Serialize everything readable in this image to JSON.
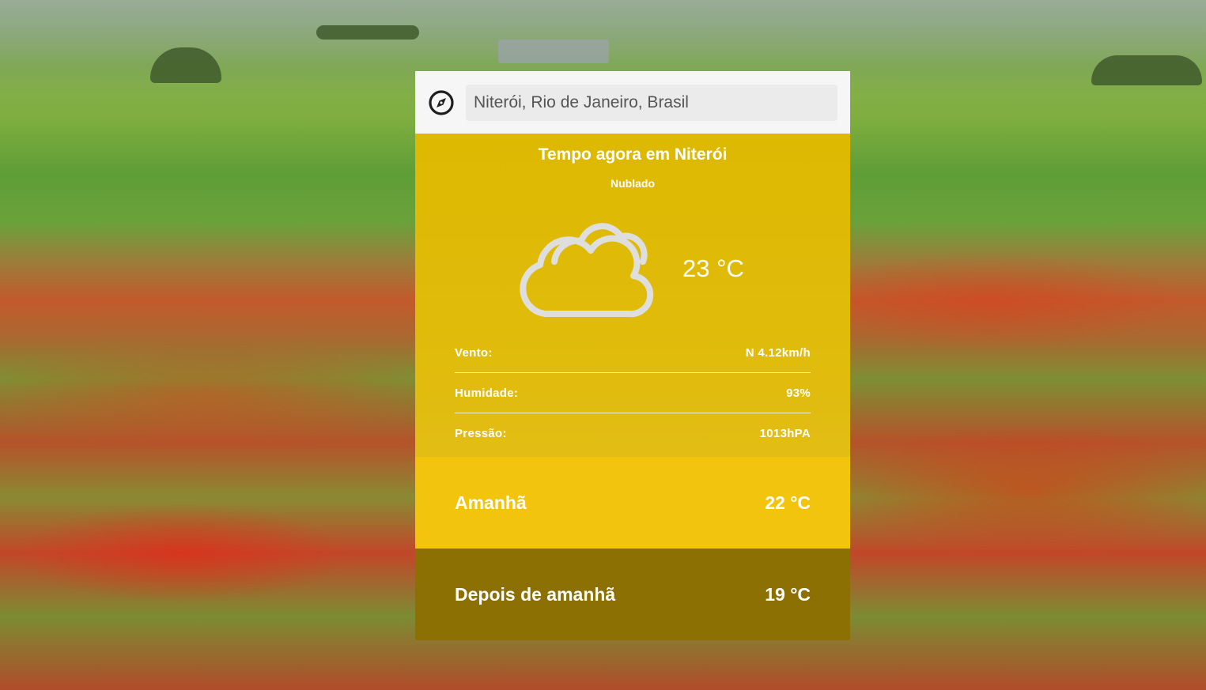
{
  "search": {
    "value": "Niterói, Rio de Janeiro, Brasil",
    "icon": "compass-icon"
  },
  "current": {
    "title": "Tempo agora em Niterói",
    "condition": "Nublado",
    "temperature": "23 °C",
    "icon": "cloudy-icon",
    "details": [
      {
        "label": "Vento:",
        "value": "N 4.12km/h"
      },
      {
        "label": "Humidade:",
        "value": "93%"
      },
      {
        "label": "Pressão:",
        "value": "1013hPA"
      }
    ]
  },
  "forecast": [
    {
      "day": "Amanhã",
      "temperature": "22 °C",
      "color": "#f2c40d"
    },
    {
      "day": "Depois de amanhã",
      "temperature": "19 °C",
      "color": "#8d7004"
    }
  ],
  "colors": {
    "today_background": "#ddb902",
    "search_background": "#f6f6f6"
  }
}
